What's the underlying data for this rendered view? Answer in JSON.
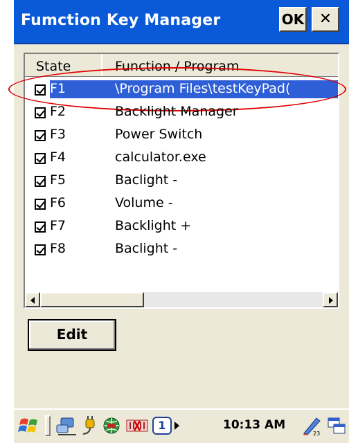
{
  "window": {
    "title": "Fumction Key Manager",
    "ok_label": "OK",
    "close_label": "✕"
  },
  "list": {
    "columns": [
      "State",
      "Function / Program"
    ],
    "rows": [
      {
        "key": "F1",
        "program": "\\Program Files\\testKeyPad(",
        "checked": true,
        "selected": true
      },
      {
        "key": "F2",
        "program": "Backlight Manager",
        "checked": true
      },
      {
        "key": "F3",
        "program": "Power Switch",
        "checked": true
      },
      {
        "key": "F4",
        "program": "calculator.exe",
        "checked": true
      },
      {
        "key": "F5",
        "program": "Baclight -",
        "checked": true
      },
      {
        "key": "F6",
        "program": "Volume -",
        "checked": true
      },
      {
        "key": "F7",
        "program": "Backlight +",
        "checked": true
      },
      {
        "key": "F8",
        "program": "Baclight -",
        "checked": true
      }
    ]
  },
  "edit_label": "Edit",
  "taskbar": {
    "time": "10:13 AM",
    "input_badge": "1",
    "icons": [
      "windows-start-icon",
      "network-icon",
      "power-plug-icon",
      "globe-icon",
      "disconnected-icon",
      "input-panel-icon",
      "keyboard-icon",
      "window-switch-icon"
    ]
  },
  "colors": {
    "titlebar": "#0a59d8",
    "selection": "#2e5fd6",
    "highlight_ring": "#e00000"
  }
}
